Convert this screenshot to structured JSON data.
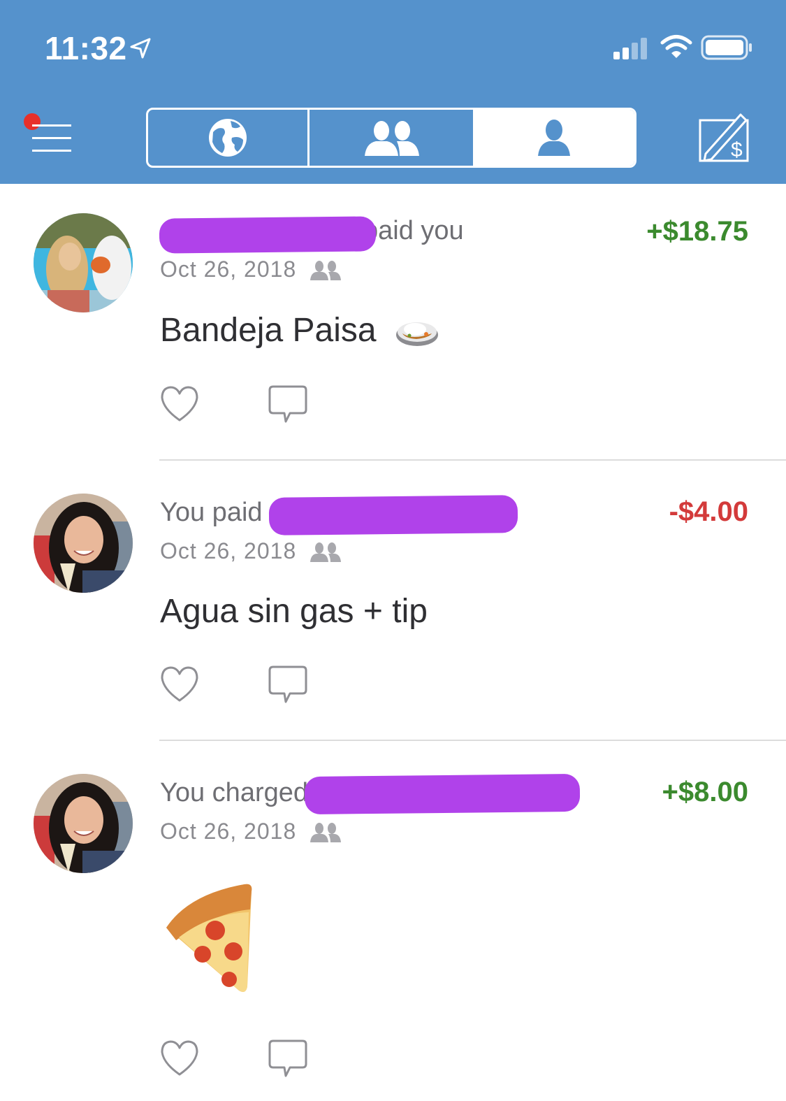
{
  "status_bar": {
    "time": "11:32",
    "location_icon": "location-arrow-icon",
    "signal_icon": "cellular-signal-icon",
    "wifi_icon": "wifi-icon",
    "battery_icon": "battery-icon"
  },
  "nav": {
    "menu_icon": "hamburger-menu-icon",
    "notification_dot_color": "#e8302a",
    "tabs": [
      {
        "name": "public",
        "icon": "globe-icon",
        "selected": false
      },
      {
        "name": "friends",
        "icon": "friends-icon",
        "selected": false
      },
      {
        "name": "mine",
        "icon": "person-icon",
        "selected": true
      }
    ],
    "pay_icon": "pay-or-request-icon",
    "bar_color": "#5592cc"
  },
  "feed": [
    {
      "title_suffix": "paid you",
      "title_prefix": "",
      "amount": "+$18.75",
      "amount_type": "positive",
      "date": "Oct 26, 2018",
      "audience_icon": "friends-icon",
      "note": "Bandeja Paisa",
      "note_emoji": "curry-rice-icon"
    },
    {
      "title_prefix": "You paid",
      "title_suffix": "",
      "amount": "-$4.00",
      "amount_type": "negative",
      "date": "Oct 26, 2018",
      "audience_icon": "friends-icon",
      "note": "Agua sin gas + tip",
      "note_emoji": ""
    },
    {
      "title_prefix": "You charged",
      "title_suffix": "",
      "amount": "+$8.00",
      "amount_type": "positive",
      "date": "Oct 26, 2018",
      "audience_icon": "friends-icon",
      "note": "",
      "note_emoji": "pizza-icon"
    }
  ],
  "colors": {
    "positive": "#3b8a2e",
    "negative": "#d33a3a",
    "redaction": "#b042ea"
  }
}
